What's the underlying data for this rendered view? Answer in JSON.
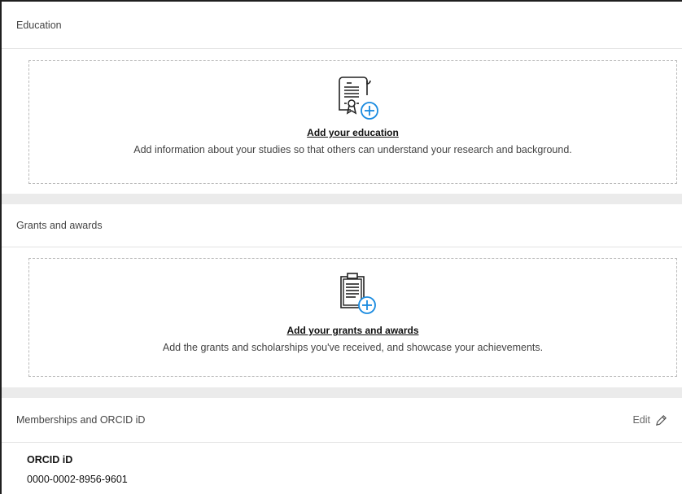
{
  "education": {
    "header": "Education",
    "add_title": "Add your education",
    "add_desc": "Add information about your studies so that others can understand your research and background."
  },
  "grants": {
    "header": "Grants and awards",
    "add_title": "Add your grants and awards",
    "add_desc": "Add the grants and scholarships you've received, and showcase your achievements."
  },
  "memberships": {
    "header": "Memberships and ORCID iD",
    "edit_label": "Edit",
    "orcid_label": "ORCID iD",
    "orcid_value": "0000-0002-8956-9601"
  },
  "colors": {
    "accent": "#1a8be0",
    "icon_stroke": "#222222"
  },
  "icons": [
    "certificate-add-icon",
    "clipboard-add-icon",
    "pencil-icon"
  ]
}
